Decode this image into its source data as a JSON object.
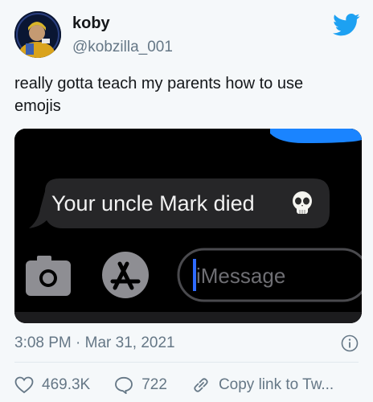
{
  "user": {
    "name": "koby",
    "handle": "@kobzilla_001"
  },
  "tweet": {
    "text": "really gotta teach my parents how to use emojis",
    "timestamp": "3:08 PM · Mar 31, 2021"
  },
  "image": {
    "message_bubble": "Your uncle Mark died",
    "message_emoji": "skull-emoji",
    "input_placeholder": "iMessage"
  },
  "actions": {
    "likes": "469.3K",
    "replies": "722",
    "copy_link": "Copy link to Tw..."
  },
  "colors": {
    "background": "#f5f8fa",
    "twitter_blue": "#1da1f2",
    "muted": "#657786",
    "bubble": "#262628"
  }
}
